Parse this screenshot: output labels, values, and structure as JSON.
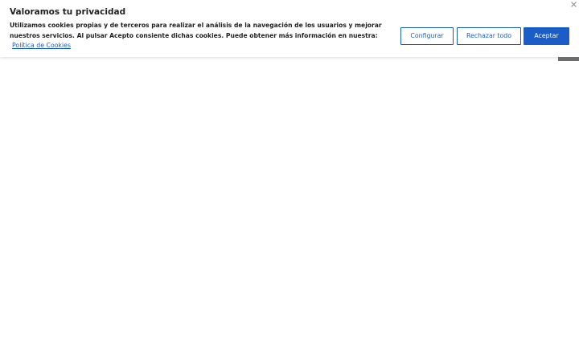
{
  "cookie_banner": {
    "title": "Valoramos tu privacidad",
    "description": "Utilizamos cookies propias y de terceros para realizar el análisis de la navegación de los usuarios y mejorar nuestros servicios. Al pulsar Acepto consiente dichas cookies. Puede obtener más información en nuestra:",
    "policy_link": "Política de Cookies",
    "buttons": {
      "configure": "Configurar",
      "reject_all": "Rechazar todo",
      "accept": "Aceptar"
    },
    "close_icon": "close-icon"
  },
  "colors": {
    "accent": "#1a5dc6",
    "text": "#212121",
    "background": "#ffffff",
    "scroll_tab": "#6d6d6d"
  }
}
